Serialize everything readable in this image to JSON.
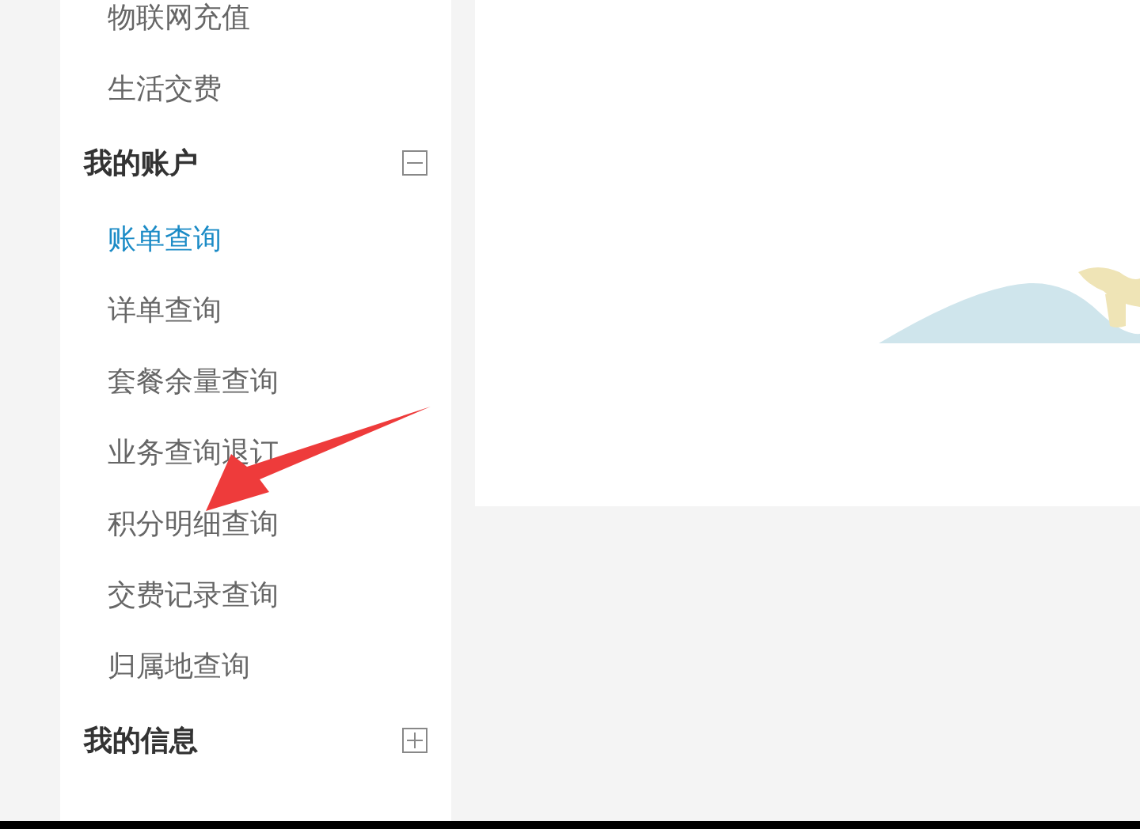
{
  "sidebar": {
    "items_above": [
      {
        "label": "物联网充值",
        "selected": false
      },
      {
        "label": "生活交费",
        "selected": false
      }
    ],
    "groups": [
      {
        "title": "我的账户",
        "expanded": true,
        "items": [
          {
            "label": "账单查询",
            "selected": true
          },
          {
            "label": "详单查询",
            "selected": false
          },
          {
            "label": "套餐余量查询",
            "selected": false
          },
          {
            "label": "业务查询退订",
            "selected": false
          },
          {
            "label": "积分明细查询",
            "selected": false
          },
          {
            "label": "交费记录查询",
            "selected": false
          },
          {
            "label": "归属地查询",
            "selected": false
          }
        ]
      },
      {
        "title": "我的信息",
        "expanded": false
      }
    ]
  },
  "annotation": {
    "kind": "arrow"
  }
}
